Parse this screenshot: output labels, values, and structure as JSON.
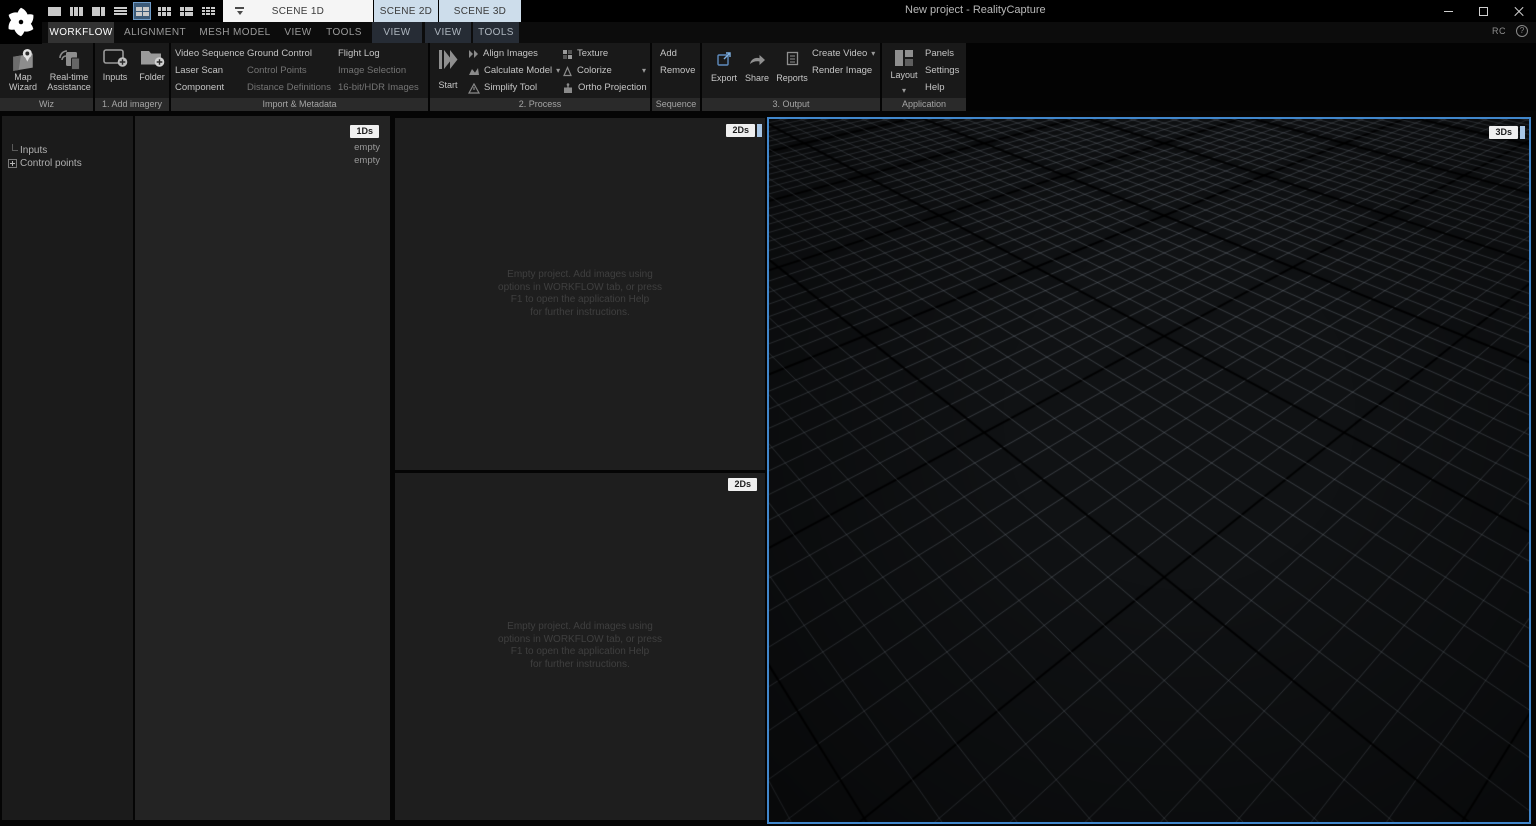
{
  "titlebar": {
    "title": "New project - RealityCapture",
    "scene_tabs": [
      {
        "label": "SCENE 1D",
        "state": "active"
      },
      {
        "label": "SCENE 2D",
        "state": "context"
      },
      {
        "label": "SCENE 3D",
        "state": "context"
      }
    ]
  },
  "icons": {
    "caret": "▾",
    "help": "?"
  },
  "ribbon_tabs": {
    "main": [
      "WORKFLOW",
      "ALIGNMENT",
      "MESH MODEL",
      "VIEW",
      "TOOLS"
    ],
    "scene2d": [
      "VIEW"
    ],
    "scene3d": [
      "VIEW",
      "TOOLS"
    ],
    "rc_label": "RC"
  },
  "ribbon": {
    "wiz": {
      "label": "Wiz",
      "map_wizard": "Map Wizard",
      "realtime": "Real-time Assistance"
    },
    "add_imagery": {
      "label": "1. Add imagery",
      "inputs": "Inputs",
      "folder": "Folder"
    },
    "import_metadata": {
      "label": "Import & Metadata",
      "col1": [
        "Video Sequence",
        "Laser Scan",
        "Component"
      ],
      "col2": [
        "Ground Control",
        "Control Points",
        "Distance Definitions"
      ],
      "col3": [
        "Flight Log",
        "Image Selection",
        "16-bit/HDR Images"
      ]
    },
    "process": {
      "label": "2. Process",
      "start": "Start",
      "col1": [
        "Align Images",
        "Calculate Model",
        "Simplify Tool"
      ],
      "col2": [
        "Texture",
        "Colorize",
        "Ortho Projection"
      ]
    },
    "sequence": {
      "label": "Sequence",
      "items": [
        "Add",
        "Remove"
      ]
    },
    "output": {
      "label": "3. Output",
      "export": "Export",
      "share": "Share",
      "reports": "Reports",
      "create_video": "Create Video",
      "render_image": "Render Image"
    },
    "application": {
      "label": "Application",
      "layout": "Layout",
      "items": [
        "Panels",
        "Settings",
        "Help"
      ]
    }
  },
  "sidebar": {
    "items": [
      "Inputs",
      "Control points"
    ]
  },
  "panel_1d": {
    "badge": "1Ds",
    "rows": [
      "empty",
      "empty"
    ]
  },
  "panel_2d_top": {
    "badge": "2Ds",
    "message": [
      "Empty project. Add images using",
      "options in WORKFLOW tab, or press",
      "F1 to open the application Help",
      "for further instructions."
    ]
  },
  "panel_2d_bottom": {
    "badge": "2Ds",
    "message": [
      "Empty project. Add images using",
      "options in WORKFLOW tab, or press",
      "F1 to open the application Help",
      "for further instructions."
    ]
  },
  "panel_3d": {
    "badge": "3Ds"
  },
  "colors": {
    "accent": "#4187cc",
    "context_tab": "#cdddeb",
    "badge_strip": "#a9c7e6"
  }
}
